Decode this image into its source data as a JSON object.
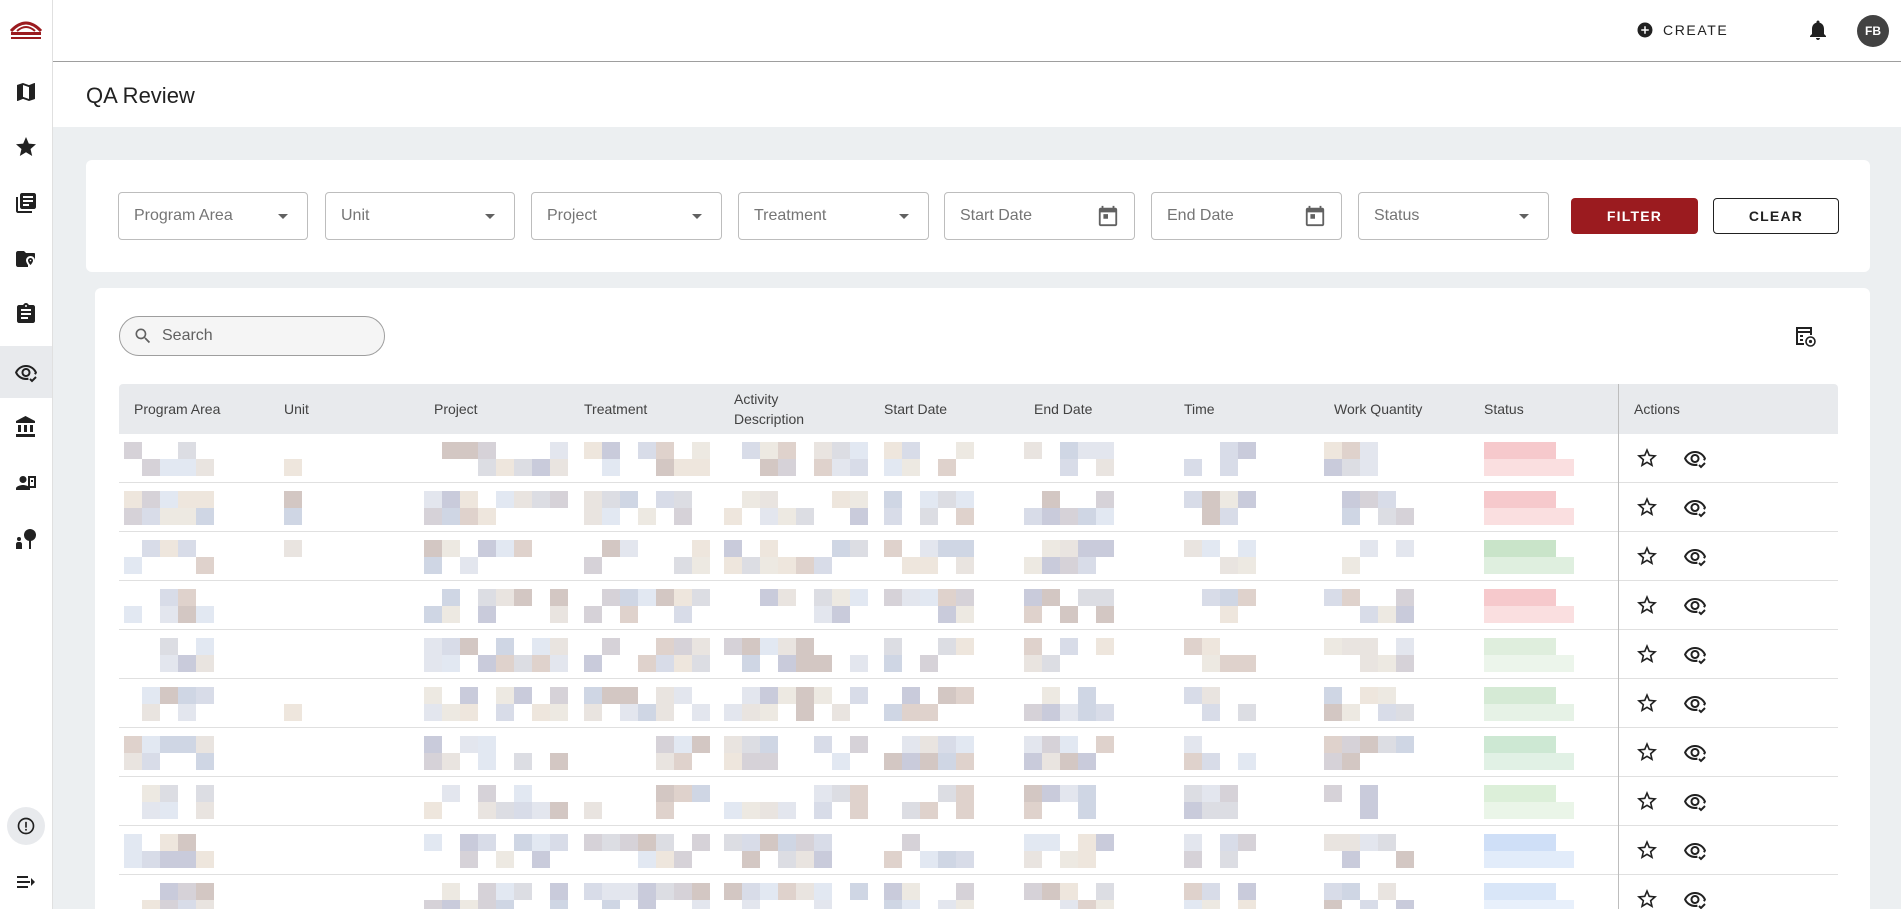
{
  "app": {
    "logo": "red-arc-logo"
  },
  "topbar": {
    "create_label": "CREATE",
    "avatar_initials": "FB"
  },
  "sidebar": {
    "items": [
      {
        "icon": "map-icon"
      },
      {
        "icon": "star-icon"
      },
      {
        "icon": "book-stack-icon"
      },
      {
        "icon": "folder-location-icon"
      },
      {
        "icon": "clipboard-icon"
      },
      {
        "icon": "eye-check-icon",
        "active": true
      },
      {
        "icon": "bank-icon"
      },
      {
        "icon": "contact-card-icon"
      },
      {
        "icon": "tree-person-icon"
      }
    ]
  },
  "page": {
    "title": "QA Review"
  },
  "filters": {
    "program_area": "Program Area",
    "unit": "Unit",
    "project": "Project",
    "treatment": "Treatment",
    "start_date": "Start Date",
    "end_date": "End Date",
    "status": "Status",
    "filter_label": "FILTER",
    "clear_label": "CLEAR"
  },
  "table": {
    "search_placeholder": "Search",
    "headers": {
      "program_area": "Program Area",
      "unit": "Unit",
      "project": "Project",
      "treatment": "Treatment",
      "activity_line1": "Activity",
      "activity_line2": "Description",
      "start_date": "Start Date",
      "end_date": "End Date",
      "time": "Time",
      "work_quantity": "Work Quantity",
      "status": "Status",
      "actions": "Actions"
    },
    "status_colors": [
      "#f6c9cc",
      "#f6c9cc",
      "#c9e4c9",
      "#f6c9cc",
      "#dfeedd",
      "#d5ead5",
      "#cde8d3",
      "#dcefd9",
      "#cfdff7",
      "#d9e6f8"
    ],
    "row_count": 10
  },
  "colors": {
    "brand": "#9b1b1f",
    "background": "#eceff1",
    "header": "#e8eaed"
  }
}
